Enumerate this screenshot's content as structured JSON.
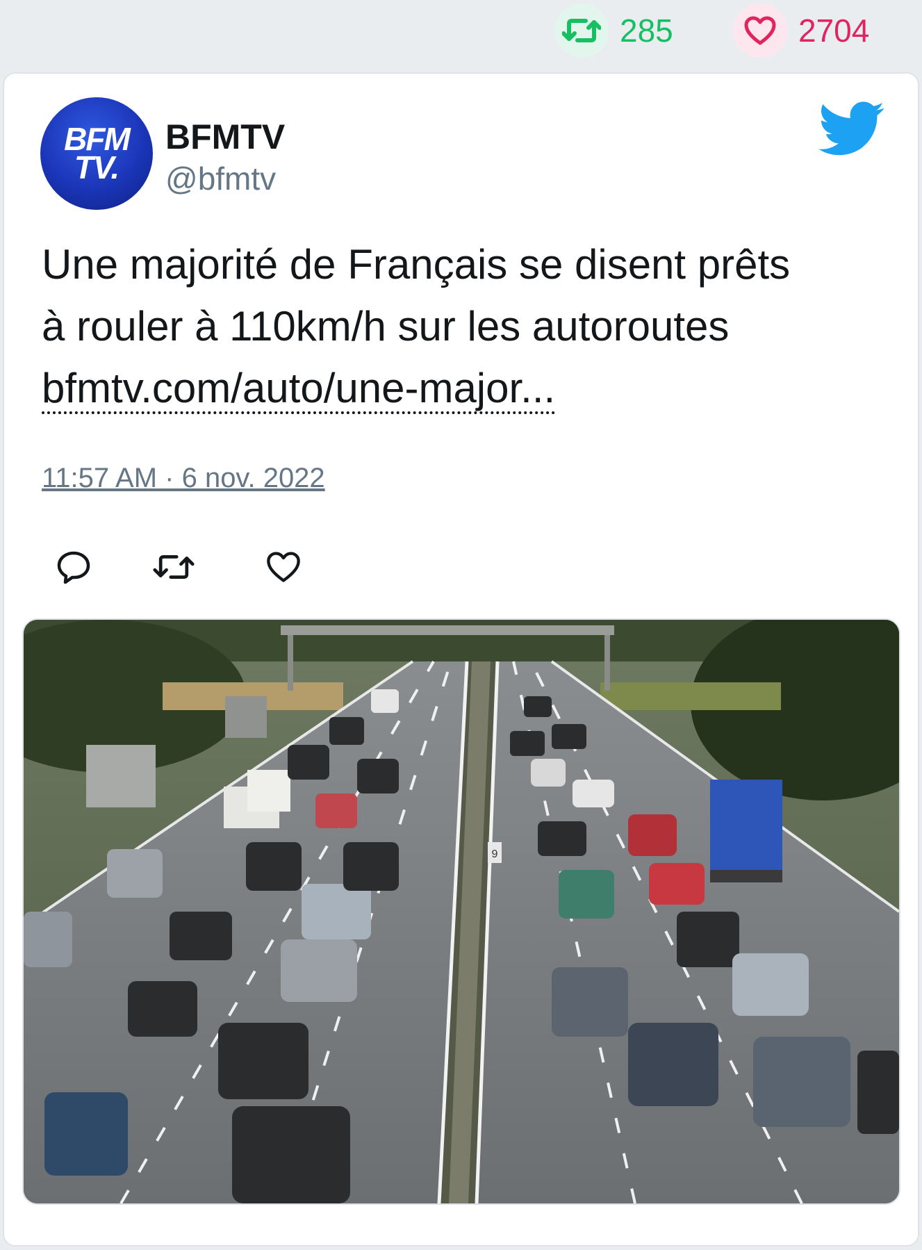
{
  "stats": {
    "retweet_count": "285",
    "like_count": "2704"
  },
  "tweet": {
    "author_name": "BFMTV",
    "author_handle": "@bfmtv",
    "avatar_text_line1": "BFM",
    "avatar_text_line2": "TV.",
    "text_line1": "Une majorité de Français se disent prêts",
    "text_line2": "à rouler à 110km/h sur les autoroutes",
    "link": "bfmtv.com/auto/une-major...",
    "timestamp": "11:57 AM · 6 nov. 2022"
  },
  "icons": {
    "retweet": "retweet-icon",
    "like": "heart-icon",
    "reply": "reply-icon",
    "brand": "twitter-bird-icon"
  },
  "media": {
    "sign_number": "9"
  },
  "colors": {
    "retweet_green": "#17bf63",
    "like_red": "#e0245e",
    "twitter_blue": "#1da1f2",
    "text": "#14171a",
    "muted": "#657786"
  }
}
